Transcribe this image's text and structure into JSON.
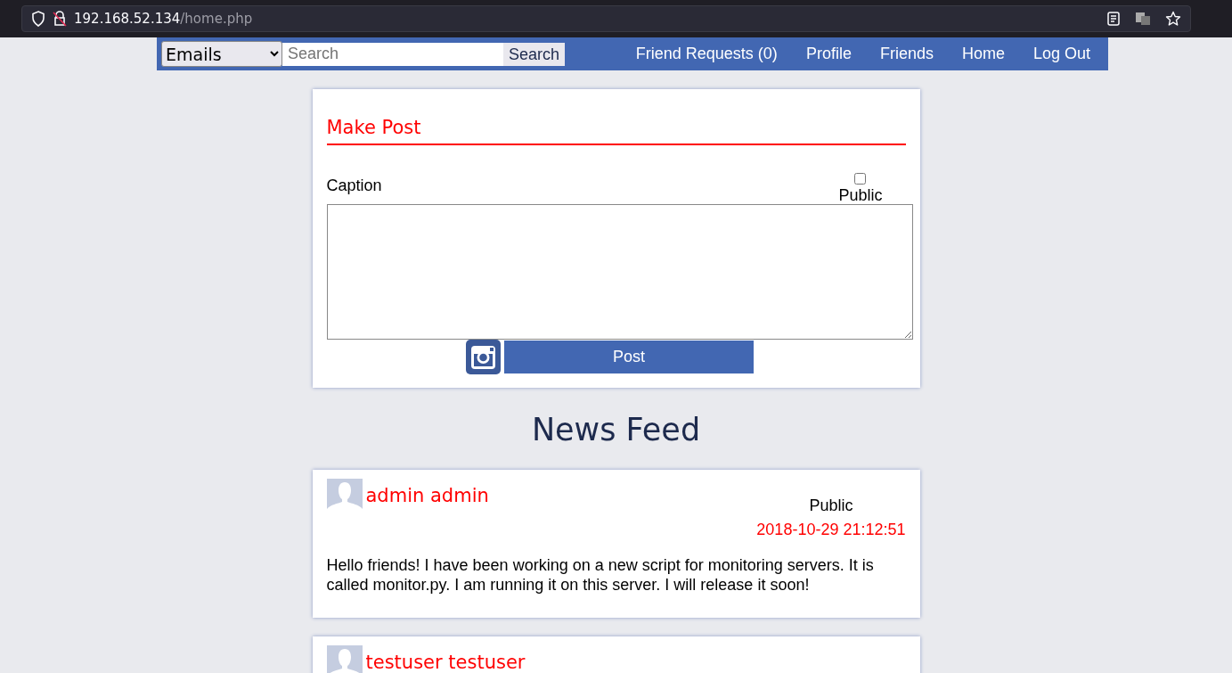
{
  "browser": {
    "address_host": "192.168.52.134",
    "address_path": "/home.php"
  },
  "navbar": {
    "search_type": "Emails",
    "search_placeholder": "Search",
    "search_button": "Search",
    "links": [
      "Friend Requests (0)",
      "Profile",
      "Friends",
      "Home",
      "Log Out"
    ]
  },
  "make_post": {
    "title": "Make Post",
    "caption_label": "Caption",
    "public_label": "Public",
    "public_checked": false,
    "post_button": "Post"
  },
  "feed_title": "News Feed",
  "posts": [
    {
      "author": "admin admin",
      "visibility": "Public",
      "timestamp": "2018-10-29 21:12:51",
      "body": "Hello friends! I have been working on a new script for monitoring servers. It is called monitor.py. I am running it on this server. I will release it soon!"
    },
    {
      "author": "testuser testuser"
    }
  ]
}
